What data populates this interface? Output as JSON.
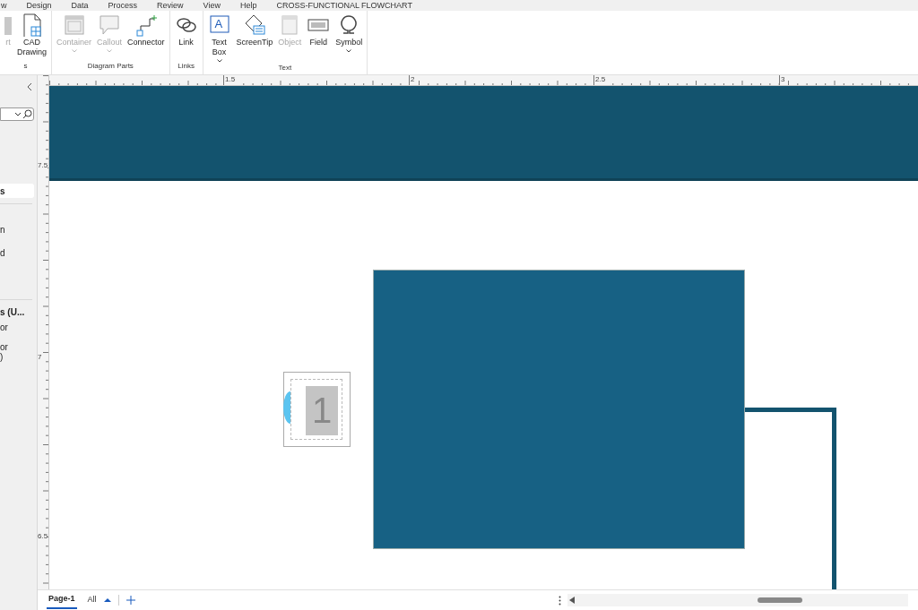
{
  "menu_tabs": [
    {
      "label": "w",
      "selected": false
    },
    {
      "label": "Design",
      "selected": false
    },
    {
      "label": "Data",
      "selected": false
    },
    {
      "label": "Process",
      "selected": false
    },
    {
      "label": "Review",
      "selected": false
    },
    {
      "label": "View",
      "selected": false
    },
    {
      "label": "Help",
      "selected": false
    },
    {
      "label": "CROSS-FUNCTIONAL FLOWCHART",
      "selected": false
    }
  ],
  "ribbon_groups": [
    {
      "label": "s",
      "buttons": [
        {
          "label": "rt",
          "kind": "partial",
          "disabled": true,
          "dropdown": false
        },
        {
          "label": "CAD Drawing",
          "kind": "cad",
          "disabled": false,
          "dropdown": false
        }
      ]
    },
    {
      "label": "Diagram Parts",
      "buttons": [
        {
          "label": "Container",
          "kind": "container",
          "disabled": true,
          "dropdown": true
        },
        {
          "label": "Callout",
          "kind": "callout",
          "disabled": true,
          "dropdown": true
        },
        {
          "label": "Connector",
          "kind": "connector",
          "disabled": false,
          "dropdown": false
        }
      ]
    },
    {
      "label": "Links",
      "buttons": [
        {
          "label": "Link",
          "kind": "link",
          "disabled": false,
          "dropdown": false
        }
      ]
    },
    {
      "label": "Text",
      "buttons": [
        {
          "label": "Text Box",
          "kind": "textbox",
          "glyph": "A",
          "disabled": false,
          "dropdown": true
        },
        {
          "label": "ScreenTip",
          "kind": "screentip",
          "disabled": false,
          "dropdown": false
        },
        {
          "label": "Object",
          "kind": "object",
          "disabled": true,
          "dropdown": false
        },
        {
          "label": "Field",
          "kind": "field",
          "disabled": false,
          "dropdown": false
        },
        {
          "label": "Symbol",
          "kind": "symbol",
          "disabled": false,
          "dropdown": true
        }
      ]
    }
  ],
  "left_pane": {
    "items": [
      {
        "label": "s",
        "selected": true,
        "bold": true
      },
      {
        "label": "n",
        "selected": false,
        "bold": false
      },
      {
        "label": "d",
        "selected": false,
        "bold": false
      },
      {
        "label": "s (U...",
        "selected": false,
        "bold": true
      },
      {
        "label": "or",
        "selected": false,
        "bold": false
      },
      {
        "label": "or",
        "selected": false,
        "bold": false
      },
      {
        "label": ")",
        "selected": false,
        "bold": false
      }
    ]
  },
  "ruler": {
    "horizontal": [
      "1.5",
      "2",
      "2.5",
      "3"
    ],
    "vertical": [
      "7.5",
      "7",
      "6.5"
    ]
  },
  "canvas": {
    "page_number": "1"
  },
  "page_tabs": [
    {
      "label": "Page-1",
      "selected": true
    },
    {
      "label": "All",
      "selected": false
    }
  ]
}
